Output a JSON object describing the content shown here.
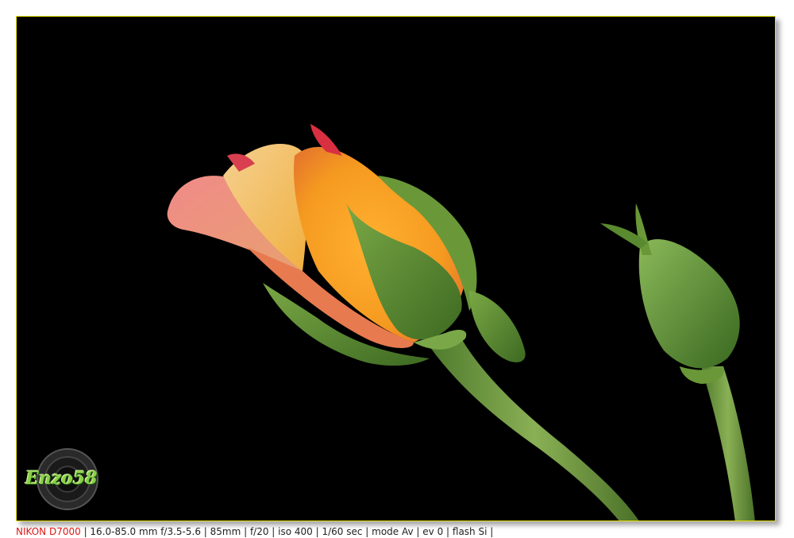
{
  "exif": {
    "camera": "NIKON D7000",
    "details": " | 16.0-85.0 mm f/3.5-5.6 | 85mm | f/20 | iso 400 | 1/60 sec | mode Av | ev 0 | flash Si |"
  },
  "watermark": {
    "text": "Enzo58"
  },
  "colors": {
    "background": "#000000",
    "frame_border": "#e8e000",
    "camera_text": "#e01818",
    "petal_orange": "#f5a020",
    "petal_pink": "#f08878",
    "sepal_green": "#5a8a30"
  }
}
